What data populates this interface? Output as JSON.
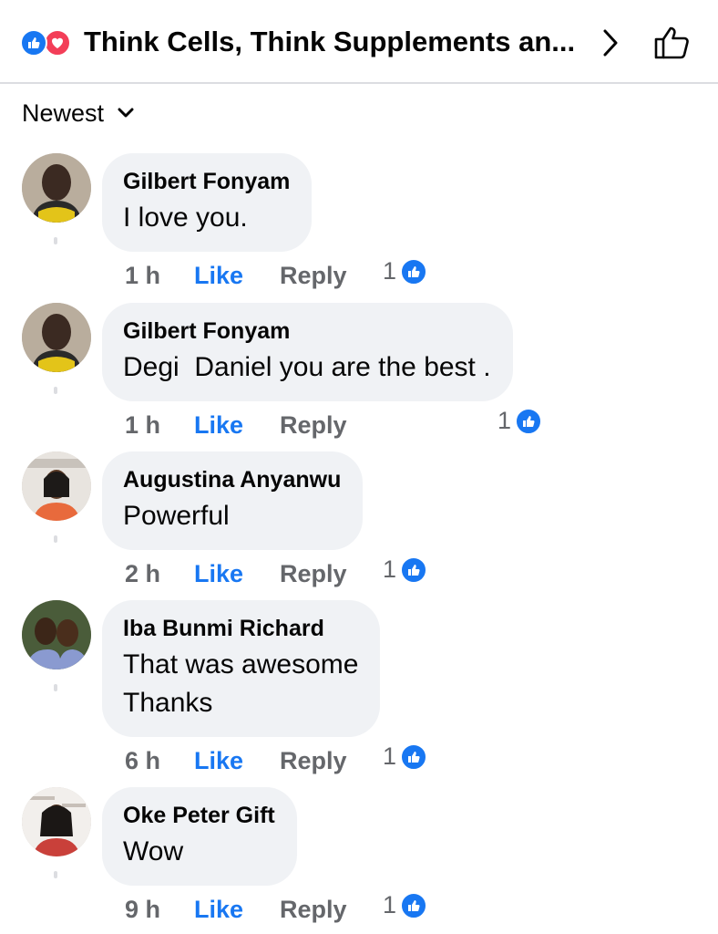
{
  "header": {
    "title": "Think Cells, Think Supplements an...",
    "reaction_icons": [
      "like-reaction-icon",
      "love-reaction-icon"
    ],
    "next_icon": "chevron-right-icon",
    "like_icon": "thumbs-up-outline-icon"
  },
  "sort": {
    "label": "Newest",
    "icon": "chevron-down-icon"
  },
  "colors": {
    "accent": "#1877f2",
    "love": "#f33e58",
    "bubble": "#f0f2f5",
    "muted": "#65676b"
  },
  "comments": [
    {
      "author": "Gilbert Fonyam",
      "text": "I love you.",
      "time": "1 h",
      "like": "Like",
      "reply": "Reply",
      "reactions": "1"
    },
    {
      "author": "Gilbert Fonyam",
      "text": "Degi  Daniel you are the best .",
      "time": "1 h",
      "like": "Like",
      "reply": "Reply",
      "reactions": "1"
    },
    {
      "author": "Augustina Anyanwu",
      "text": "Powerful",
      "time": "2 h",
      "like": "Like",
      "reply": "Reply",
      "reactions": "1"
    },
    {
      "author": "Iba Bunmi Richard",
      "text": "That was awesome\nThanks",
      "time": "6 h",
      "like": "Like",
      "reply": "Reply",
      "reactions": "1"
    },
    {
      "author": "Oke Peter Gift",
      "text": "Wow",
      "time": "9 h",
      "like": "Like",
      "reply": "Reply",
      "reactions": "1"
    }
  ]
}
